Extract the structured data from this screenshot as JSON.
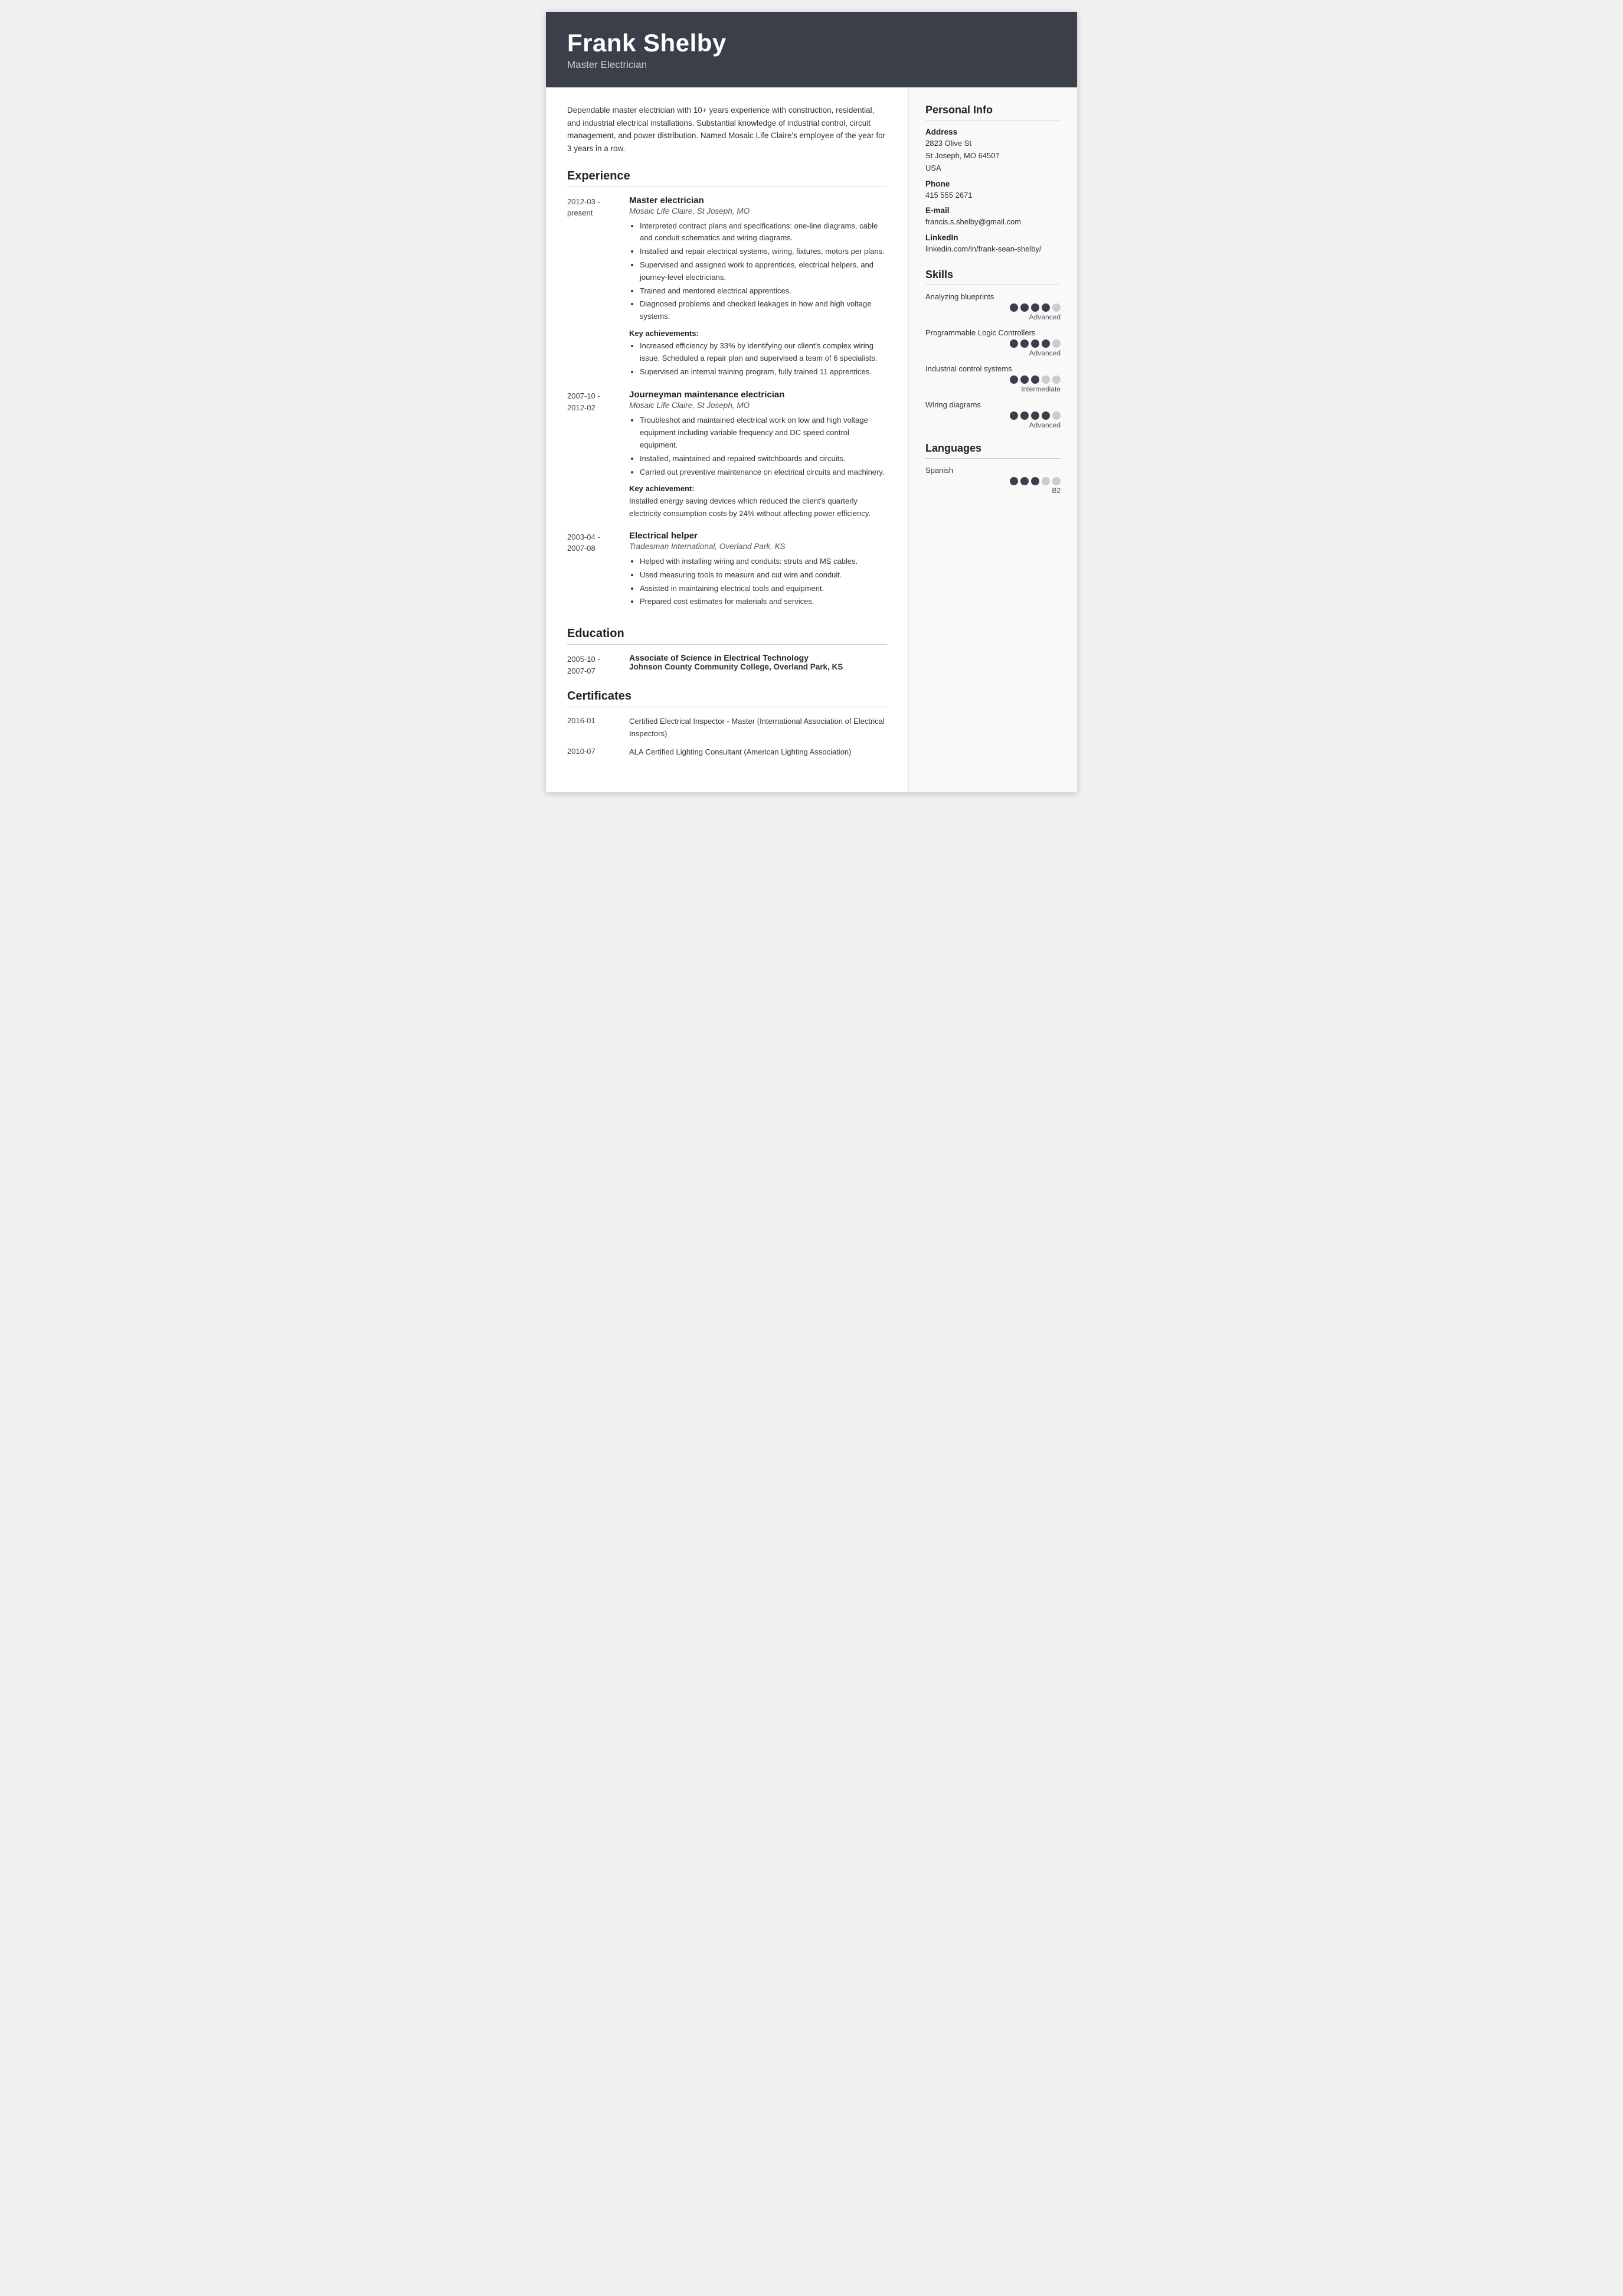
{
  "header": {
    "name": "Frank Shelby",
    "title": "Master Electrician"
  },
  "summary": "Dependable master electrician with 10+ years experience with construction, residential, and industrial electrical installations. Substantial knowledge of industrial control, circuit management, and power distribution. Named Mosaic Life Claire's employee of the year for 3 years in a row.",
  "experience": {
    "section_title": "Experience",
    "entries": [
      {
        "date": "2012-03 -\npresent",
        "job_title": "Master electrician",
        "company": "Mosaic Life Claire, St Joseph, MO",
        "bullets": [
          "Interpreted contract plans and specifications: one-line diagrams, cable and conduit schematics and wiring diagrams.",
          "Installed and repair electrical systems, wiring, fixtures, motors per plans.",
          "Supervised and assigned work to apprentices, electrical helpers, and journey-level electricians.",
          "Trained and mentored electrical apprentices.",
          "Diagnosed problems and checked leakages in how and high voltage systems."
        ],
        "key_ach_label": "Key achievements:",
        "key_ach_type": "bullets",
        "key_ach_bullets": [
          "Increased efficiency by 33% by identifying our client's complex wiring issue. Scheduled a repair plan and supervised a team of 6 specialists.",
          "Supervised an internal training program, fully trained 11 apprentices."
        ],
        "key_ach_text": ""
      },
      {
        "date": "2007-10 -\n2012-02",
        "job_title": "Journeyman maintenance electrician",
        "company": "Mosaic Life Claire, St Joseph, MO",
        "bullets": [
          "Troubleshot and maintained electrical work on low and high voltage equipment including variable frequency and DC speed control equipment.",
          "Installed, maintained and repaired switchboards and circuits.",
          "Carried out preventive maintenance on electrical circuits and machinery."
        ],
        "key_ach_label": "Key achievement:",
        "key_ach_type": "text",
        "key_ach_text": "Installed energy saving devices which reduced the client's quarterly electricity consumption costs by 24% without affecting power efficiency.",
        "key_ach_bullets": []
      },
      {
        "date": "2003-04 -\n2007-08",
        "job_title": "Electrical helper",
        "company": "Tradesman International, Overland Park, KS",
        "bullets": [
          "Helped with installing wiring and conduits: struts and MS cables.",
          "Used measuring tools to measure and cut wire and conduit.",
          "Assisted in maintaining electrical tools and equipment.",
          "Prepared cost estimates for materials and services."
        ],
        "key_ach_label": "",
        "key_ach_type": "none",
        "key_ach_text": "",
        "key_ach_bullets": []
      }
    ]
  },
  "education": {
    "section_title": "Education",
    "entries": [
      {
        "date": "2005-10 -\n2007-07",
        "degree": "Associate of Science in Electrical Technology",
        "school": "Johnson County Community College, Overland Park, KS"
      }
    ]
  },
  "certificates": {
    "section_title": "Certificates",
    "entries": [
      {
        "date": "2016-01",
        "description": "Certified Electrical Inspector - Master (International Association of Electrical Inspectors)"
      },
      {
        "date": "2010-07",
        "description": "ALA Certified Lighting Consultant (American Lighting Association)"
      }
    ]
  },
  "personal_info": {
    "section_title": "Personal Info",
    "address_label": "Address",
    "address": "2823 Olive St\nSt Joseph, MO 64507\nUSA",
    "phone_label": "Phone",
    "phone": "415 555 2671",
    "email_label": "E-mail",
    "email": "francis.s.shelby@gmail.com",
    "linkedin_label": "LinkedIn",
    "linkedin": "linkedin.com/in/frank-sean-shelby/"
  },
  "skills": {
    "section_title": "Skills",
    "entries": [
      {
        "name": "Analyzing blueprints",
        "filled": 4,
        "total": 5,
        "level": "Advanced"
      },
      {
        "name": "Programmable Logic Controllers",
        "filled": 4,
        "total": 5,
        "level": "Advanced"
      },
      {
        "name": "Industrial control systems",
        "filled": 3,
        "total": 5,
        "level": "Intermediate"
      },
      {
        "name": "Wiring diagrams",
        "filled": 4,
        "total": 5,
        "level": "Advanced"
      }
    ]
  },
  "languages": {
    "section_title": "Languages",
    "entries": [
      {
        "name": "Spanish",
        "filled": 3,
        "total": 5,
        "level": "B2"
      }
    ]
  }
}
